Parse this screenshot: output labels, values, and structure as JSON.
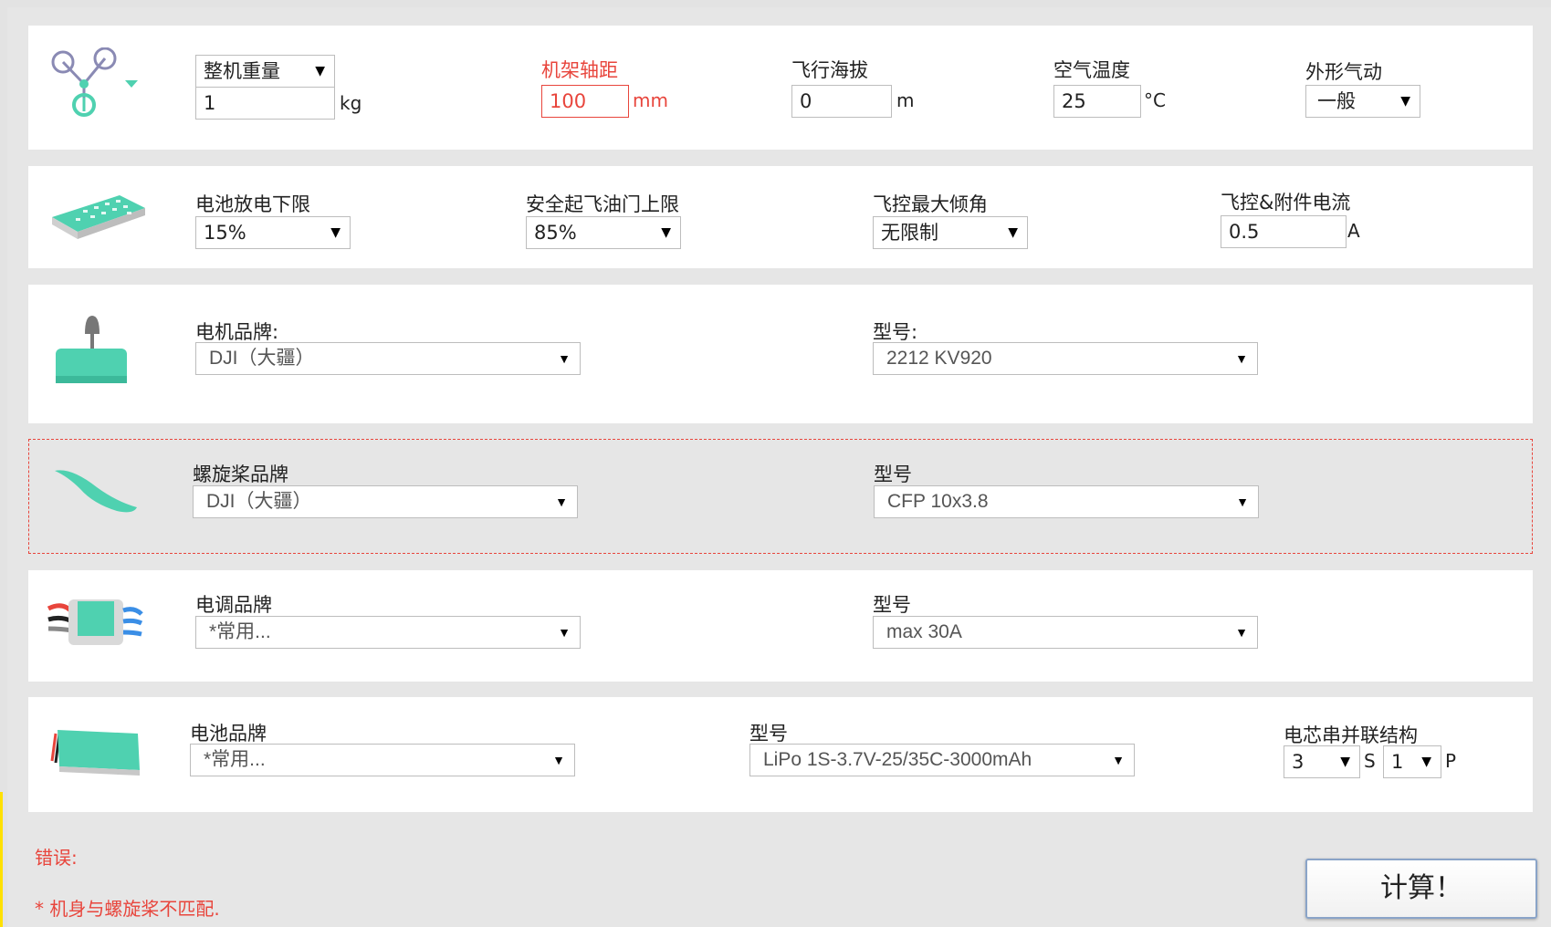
{
  "frame": {
    "weight_mode": "整机重量",
    "weight_value": "1",
    "weight_unit": "kg",
    "wheelbase_label": "机架轴距",
    "wheelbase_value": "100",
    "wheelbase_unit": "mm",
    "altitude_label": "飞行海拔",
    "altitude_value": "0",
    "altitude_unit": "m",
    "temp_label": "空气温度",
    "temp_value": "25",
    "temp_unit": "°C",
    "aero_label": "外形气动",
    "aero_value": "一般"
  },
  "flight": {
    "battery_min_label": "电池放电下限",
    "battery_min_value": "15%",
    "throttle_label": "安全起飞油门上限",
    "throttle_value": "85%",
    "tilt_label": "飞控最大倾角",
    "tilt_value": "无限制",
    "current_label": "飞控&附件电流",
    "current_value": "0.5",
    "current_unit": "A"
  },
  "motor": {
    "brand_label": "电机品牌:",
    "brand_value": "DJI（大疆）",
    "model_label": "型号:",
    "model_value": "2212 KV920"
  },
  "propeller": {
    "brand_label": "螺旋桨品牌",
    "brand_value": "DJI（大疆）",
    "model_label": "型号",
    "model_value": "CFP 10x3.8"
  },
  "esc": {
    "brand_label": "电调品牌",
    "brand_value": "*常用...",
    "model_label": "型号",
    "model_value": "max 30A"
  },
  "battery": {
    "brand_label": "电池品牌",
    "brand_value": "*常用...",
    "model_label": "型号",
    "model_value": "LiPo 1S-3.7V-25/35C-3000mAh",
    "cells_label": "电芯串并联结构",
    "series_value": "3",
    "series_unit": "S",
    "parallel_value": "1",
    "parallel_unit": "P"
  },
  "error": {
    "title": "错误:",
    "message": "* 机身与螺旋桨不匹配."
  },
  "calculate_label": "计算！",
  "colors": {
    "accent": "#4fd1b0",
    "error": "#e8453c",
    "panel_bg": "#ffffff",
    "page_bg": "#e3e3e3"
  }
}
